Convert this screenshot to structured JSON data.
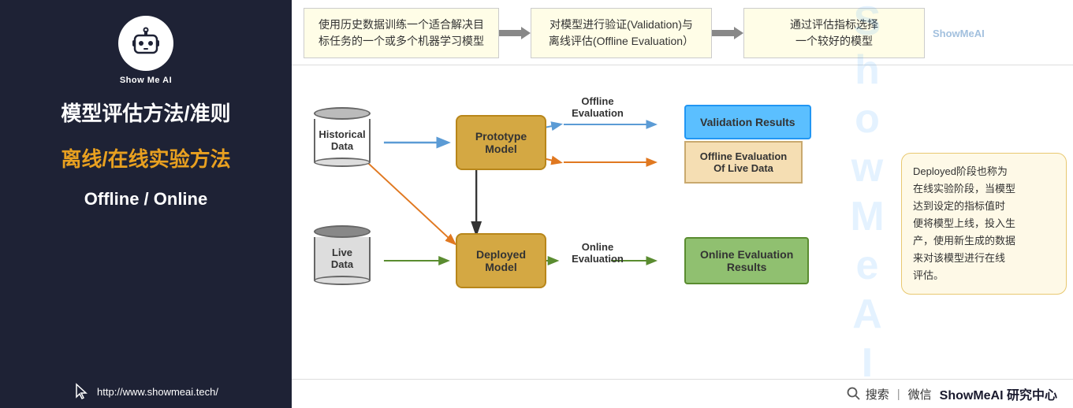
{
  "sidebar": {
    "logo_text": "Show Me AI",
    "title": "模型评估方法/准则",
    "subtitle": "离线/在线实验方法",
    "english_label": "Offline / Online",
    "footer_url": "http://www.showmeai.tech/"
  },
  "steps": {
    "step1": "使用历史数据训练一个适合解决目\n标任务的一个或多个机器学习模型",
    "step2": "对模型进行验证(Validation)与\n离线评估(Offline Evaluation）",
    "step3": "通过评估指标选择\n一个较好的模型"
  },
  "diagram": {
    "hist_data": "Historical\nData",
    "live_data": "Live\nData",
    "prototype_model": "Prototype\nModel",
    "deployed_model": "Deployed\nModel",
    "offline_eval_label": "Offline\nEvaluation",
    "online_eval_label": "Online\nEvaluation",
    "validation_results": "Validation Results",
    "offline_live": "Offline Evaluation\nOf Live Data",
    "online_results": "Online Evaluation\nResults",
    "explanation": "Deployed阶段也称为\n在线实验阶段，当模型\n达到设定的指标值时\n便将模型上线，投入生\n产，使用新生成的数据\n来对该模型进行在线\n评估。"
  },
  "footer": {
    "search": "搜索",
    "divider": "|",
    "wechat": "微信",
    "brand": "ShowMeAI 研究中心"
  },
  "colors": {
    "sidebar_bg": "#1e2235",
    "accent_orange": "#e8a020",
    "step_bg": "#fffde7",
    "model_gold": "#d4a843",
    "result_blue": "#5bbfff",
    "result_tan": "#f5deb3",
    "result_green": "#90c070",
    "explain_bg": "#fef9e7"
  }
}
